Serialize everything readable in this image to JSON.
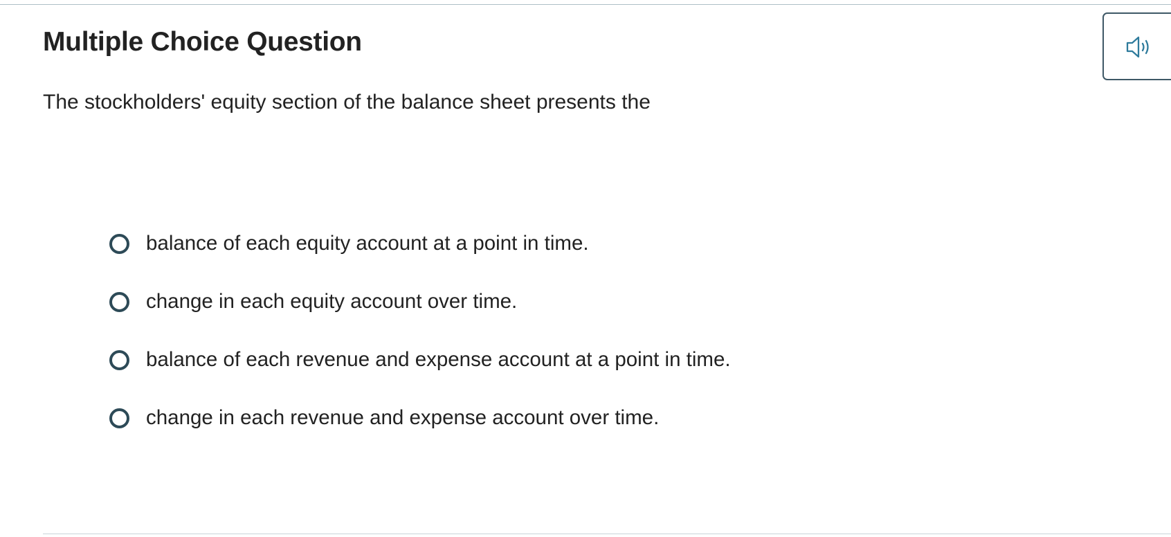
{
  "question": {
    "title": "Multiple Choice Question",
    "prompt": "The stockholders' equity section of the balance sheet presents the",
    "audio_icon": "speaker-icon",
    "options": [
      {
        "label": "balance of each equity account at a point in time."
      },
      {
        "label": "change in each equity account over time."
      },
      {
        "label": "balance of each revenue and expense account at a point in time."
      },
      {
        "label": "change in each revenue and expense account over time."
      }
    ]
  },
  "colors": {
    "radio_border": "#2d4a57",
    "audio_border": "#3e5866",
    "audio_icon": "#2e7b9c",
    "rule": "#aebfc6"
  }
}
